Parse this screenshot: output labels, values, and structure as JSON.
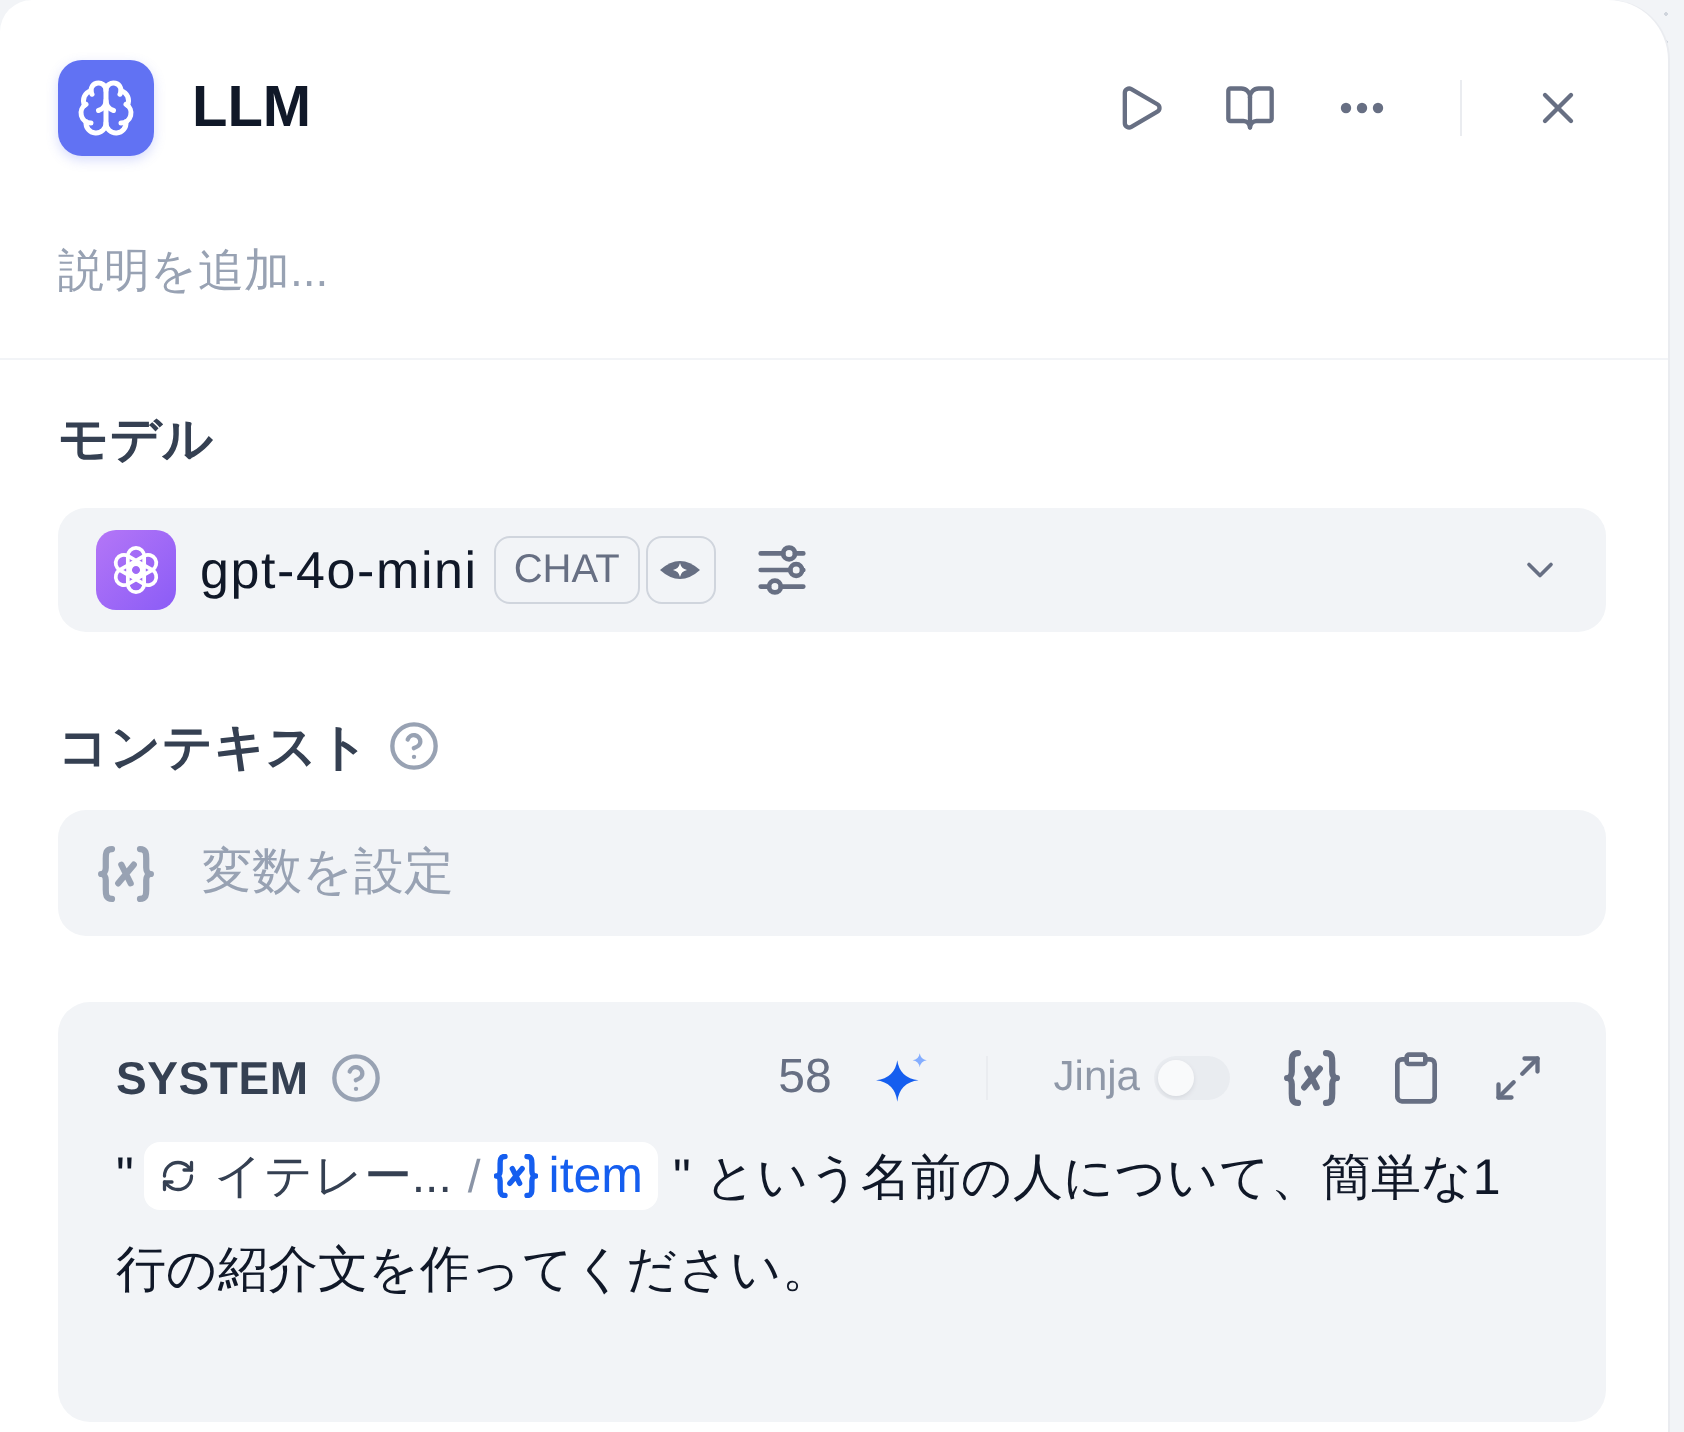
{
  "panel": {
    "title": "LLM",
    "description": {
      "placeholder": "説明を追加..."
    }
  },
  "model_section": {
    "label": "モデル",
    "model": {
      "name": "gpt-4o-mini",
      "mode": "CHAT",
      "vision": true
    }
  },
  "context_section": {
    "label": "コンテキスト",
    "variable_field": {
      "placeholder": "変数を設定"
    }
  },
  "system_prompt": {
    "role": "SYSTEM",
    "char_count": "58",
    "jinja": {
      "label": "Jinja",
      "on": false,
      "disabled": true
    },
    "lines": [
      [
        {
          "kind": "text",
          "text": "\""
        },
        {
          "kind": "variable",
          "node": "イテレー...",
          "separator": "/",
          "name": "item"
        },
        {
          "kind": "text",
          "text": "\" という名前の人について、簡単な1"
        }
      ],
      [
        {
          "kind": "text",
          "text": "行の紹介文を作ってください。"
        }
      ]
    ]
  }
}
